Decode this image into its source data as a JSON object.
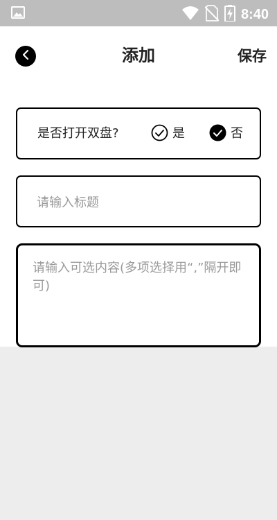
{
  "status_bar": {
    "time": "8:40",
    "icons": [
      "image-icon",
      "wifi-icon",
      "no-sim-icon",
      "battery-charging-icon"
    ]
  },
  "nav": {
    "back_icon": "chevron-left-icon",
    "title": "添加",
    "save_label": "保存"
  },
  "toggle": {
    "question": "是否打开双盘?",
    "option_yes": "是",
    "option_no": "否",
    "selected": "否"
  },
  "title_input": {
    "value": "",
    "placeholder": "请输入标题"
  },
  "options_input": {
    "value": "",
    "placeholder": "请输入可选内容(多项选择用“,”隔开即可)"
  },
  "colors": {
    "status_bar": "#bdbdbd",
    "page_background": "#ededed",
    "card_border": "#000000",
    "placeholder": "#9a9a9a"
  }
}
